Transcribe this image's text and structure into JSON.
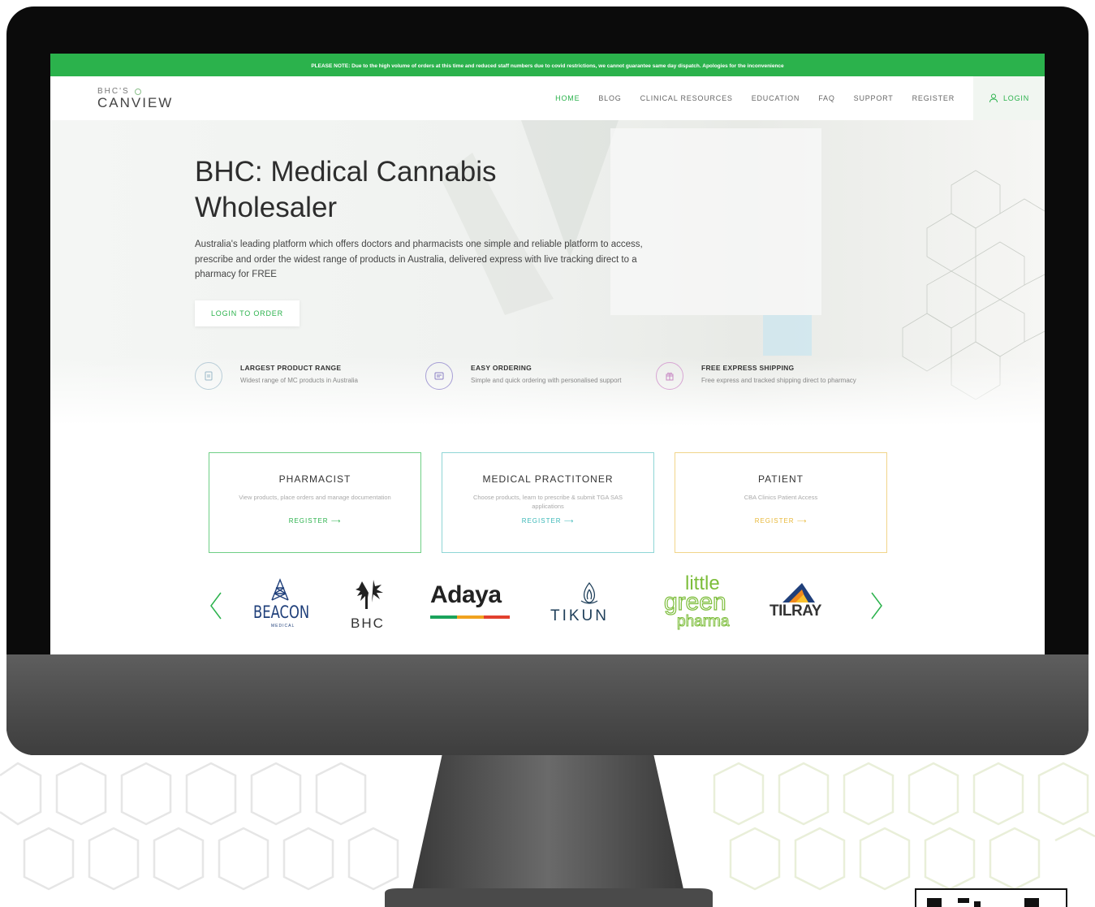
{
  "notice": {
    "text": "PLEASE NOTE: Due to the high volume of orders at this time and reduced staff numbers due to covid restrictions, we cannot guarantee same day dispatch. Apologies for the inconvenience"
  },
  "logo": {
    "top": "BHC'S",
    "main": "CANVIEW"
  },
  "nav": {
    "items": [
      "HOME",
      "BLOG",
      "CLINICAL RESOURCES",
      "EDUCATION",
      "FAQ",
      "SUPPORT",
      "REGISTER"
    ],
    "active": "HOME",
    "login": "LOGIN"
  },
  "hero": {
    "title_line1": "BHC: Medical Cannabis",
    "title_line2": "Wholesaler",
    "description": "Australia's leading platform which offers doctors and pharmacists one simple and reliable platform to access, prescribe and order the widest range of products in Australia, delivered express with live tracking direct to a pharmacy for FREE",
    "button": "LOGIN TO ORDER"
  },
  "features": [
    {
      "title": "LARGEST PRODUCT RANGE",
      "text": "Widest range of MC products in Australia",
      "icon": "product-box-icon",
      "color": "#9bb8c8"
    },
    {
      "title": "EASY ORDERING",
      "text": "Simple and quick ordering with personalised support",
      "icon": "order-window-icon",
      "color": "#8a7fc4"
    },
    {
      "title": "FREE EXPRESS SHIPPING",
      "text": "Free express and tracked shipping direct to pharmacy",
      "icon": "shipping-gift-icon",
      "color": "#c88ac4"
    }
  ],
  "cards": [
    {
      "title": "PHARMACIST",
      "text": "View products, place orders and manage documentation",
      "link": "REGISTER",
      "border": "#6fcf85",
      "link_color": "#2bb24c"
    },
    {
      "title": "MEDICAL PRACTITONER",
      "text": "Choose products, learn to prescribe & submit TGA SAS applications",
      "link": "REGISTER",
      "border": "#8fd6d6",
      "link_color": "#3cb8b8"
    },
    {
      "title": "PATIENT",
      "text": "CBA Clinics Patient Access",
      "link": "REGISTER",
      "border": "#f1d58a",
      "link_color": "#e8b83a"
    }
  ],
  "brands": {
    "beacon": {
      "name": "BEACON",
      "sub": "MEDICAL"
    },
    "bhc": "BHC",
    "adaya": "Adaya",
    "tikun": "TIKUN",
    "lgp": {
      "l1": "little",
      "l2": "green",
      "l3": "pharma"
    },
    "tilray": "TILRAY"
  },
  "colors": {
    "accent": "#2bb24c",
    "notice_bg": "#2bb24c"
  }
}
